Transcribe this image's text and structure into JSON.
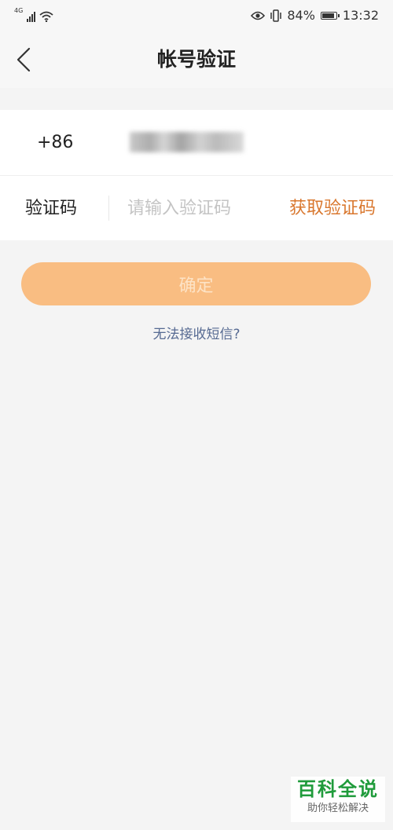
{
  "status_bar": {
    "network": "4G",
    "battery_percent": "84%",
    "time": "13:32",
    "icons": [
      "signal-icon",
      "wifi-icon",
      "eye-icon",
      "vibrate-icon",
      "battery-icon"
    ]
  },
  "nav": {
    "back_icon": "chevron-left-icon",
    "title": "帐号验证"
  },
  "form": {
    "country_code": "+86",
    "phone_value": "",
    "code_label": "验证码",
    "code_placeholder": "请输入验证码",
    "code_value": "",
    "get_code_label": "获取验证码"
  },
  "actions": {
    "confirm_label": "确定",
    "no_sms_link": "无法接收短信?"
  },
  "watermark": {
    "title": "百科全说",
    "subtitle": "助你轻松解决"
  },
  "colors": {
    "accent": "#d9772e",
    "button_bg": "#f9bd82",
    "link": "#566a92",
    "page_bg": "#f4f4f4"
  }
}
